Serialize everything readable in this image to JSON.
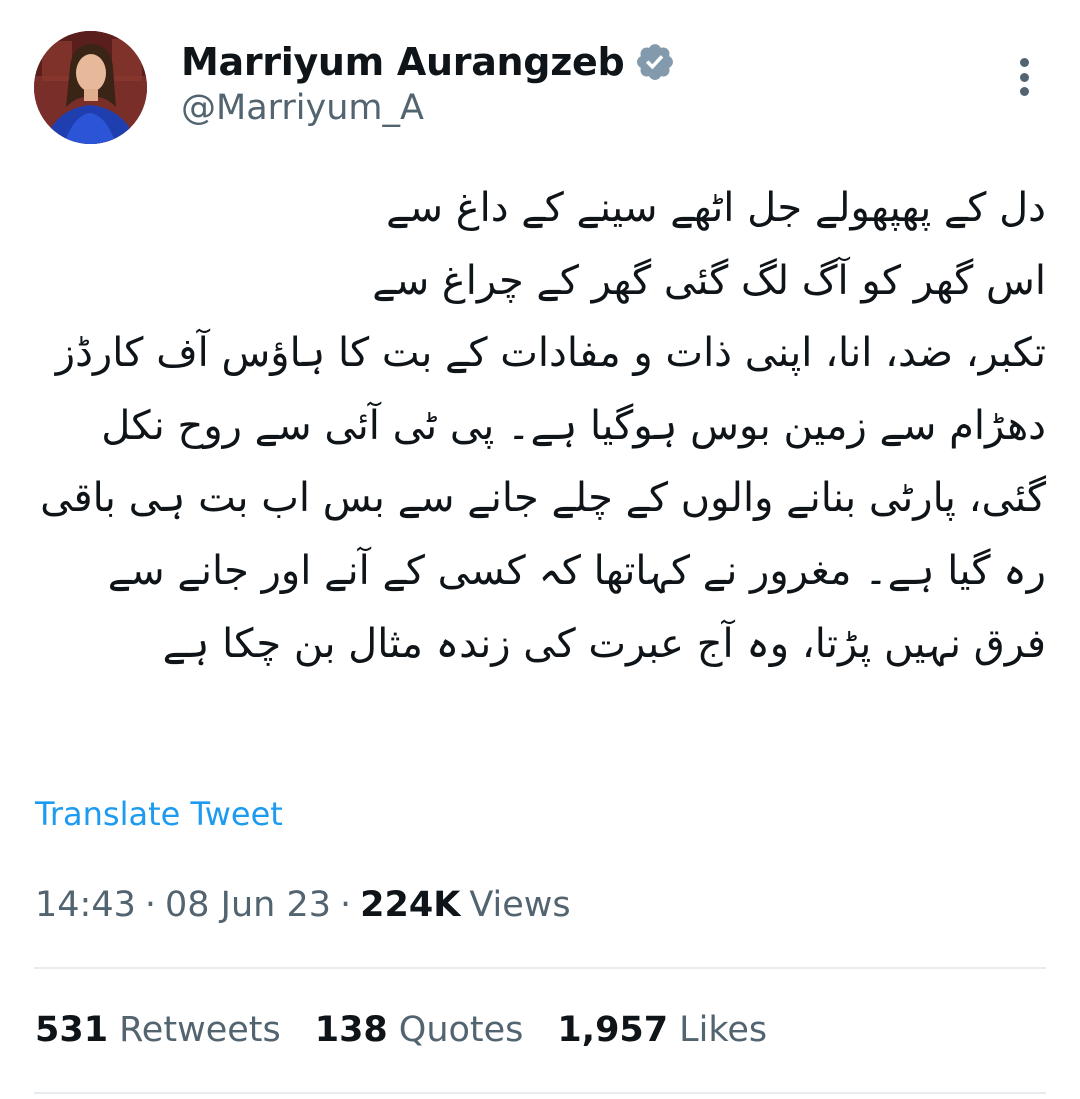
{
  "author": {
    "display_name": "Marriyum Aurangzeb",
    "handle": "@Marriyum_A",
    "verified_color": "#829aab"
  },
  "tweet": {
    "text": "دل کے پھپھولے جل اٹھے سینے کے داغ سے\nاس گھر کو آگ لگ گئی گھر کے چراغ سے\nتکبر، ضد، انا، اپنی ذات و مفادات کے بت کا ہاؤس آف کارڈز دھڑام سے زمین بوس ہوگیا ہے۔ پی ٹی آئی سے روح نکل گئی، پارٹی بنانے والوں کے چلے جانے سے بس اب بت ہی باقی رہ گیا ہے۔ مغرور نے کہاتھا کہ کسی کے آنے اور جانے سے فرق نہیں پڑتا، وہ آج عبرت کی زندہ مثال بن چکا ہے",
    "translate_label": "Translate Tweet",
    "time": "14:43",
    "date": "08 Jun 23",
    "separator": "·",
    "views_count": "224K",
    "views_label": "Views"
  },
  "stats": {
    "retweets_count": "531",
    "retweets_label": "Retweets",
    "quotes_count": "138",
    "quotes_label": "Quotes",
    "likes_count": "1,957",
    "likes_label": "Likes"
  },
  "colors": {
    "link": "#1d9bf0",
    "secondary_text": "#536471",
    "primary_text": "#0f1419",
    "divider": "#e6ecf0"
  },
  "icons": {
    "verified": "verified-badge-icon",
    "more": "more-options-icon"
  }
}
